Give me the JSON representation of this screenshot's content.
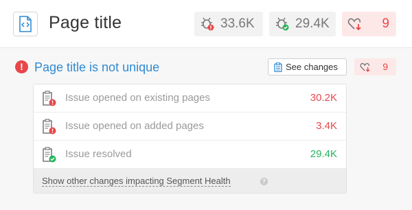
{
  "header": {
    "title": "Page title",
    "stats": {
      "pages_with_issues": "33.6K",
      "pages_ok": "29.4K",
      "health": "9"
    }
  },
  "issue": {
    "title": "Page title is not unique",
    "see_changes_label": "See changes",
    "health": "9"
  },
  "changes": {
    "rows": [
      {
        "label": "Issue opened on existing pages",
        "value": "30.2K",
        "status": "opened"
      },
      {
        "label": "Issue opened on added pages",
        "value": "3.4K",
        "status": "opened"
      },
      {
        "label": "Issue resolved",
        "value": "29.4K",
        "status": "resolved"
      }
    ],
    "footer_link": "Show other changes impacting Segment Health"
  },
  "colors": {
    "accent_blue": "#2f8ad3",
    "error_red": "#e8474a",
    "success_green": "#27b35d"
  },
  "icons": {
    "header": "code-file-icon",
    "bug_error": "bug-error-icon",
    "bug_ok": "bug-ok-icon",
    "health_down": "heart-down-icon",
    "alert": "alert-circle-icon",
    "clipboard": "clipboard-icon",
    "doc_error": "document-error-icon",
    "doc_ok": "document-ok-icon",
    "help": "help-icon"
  }
}
